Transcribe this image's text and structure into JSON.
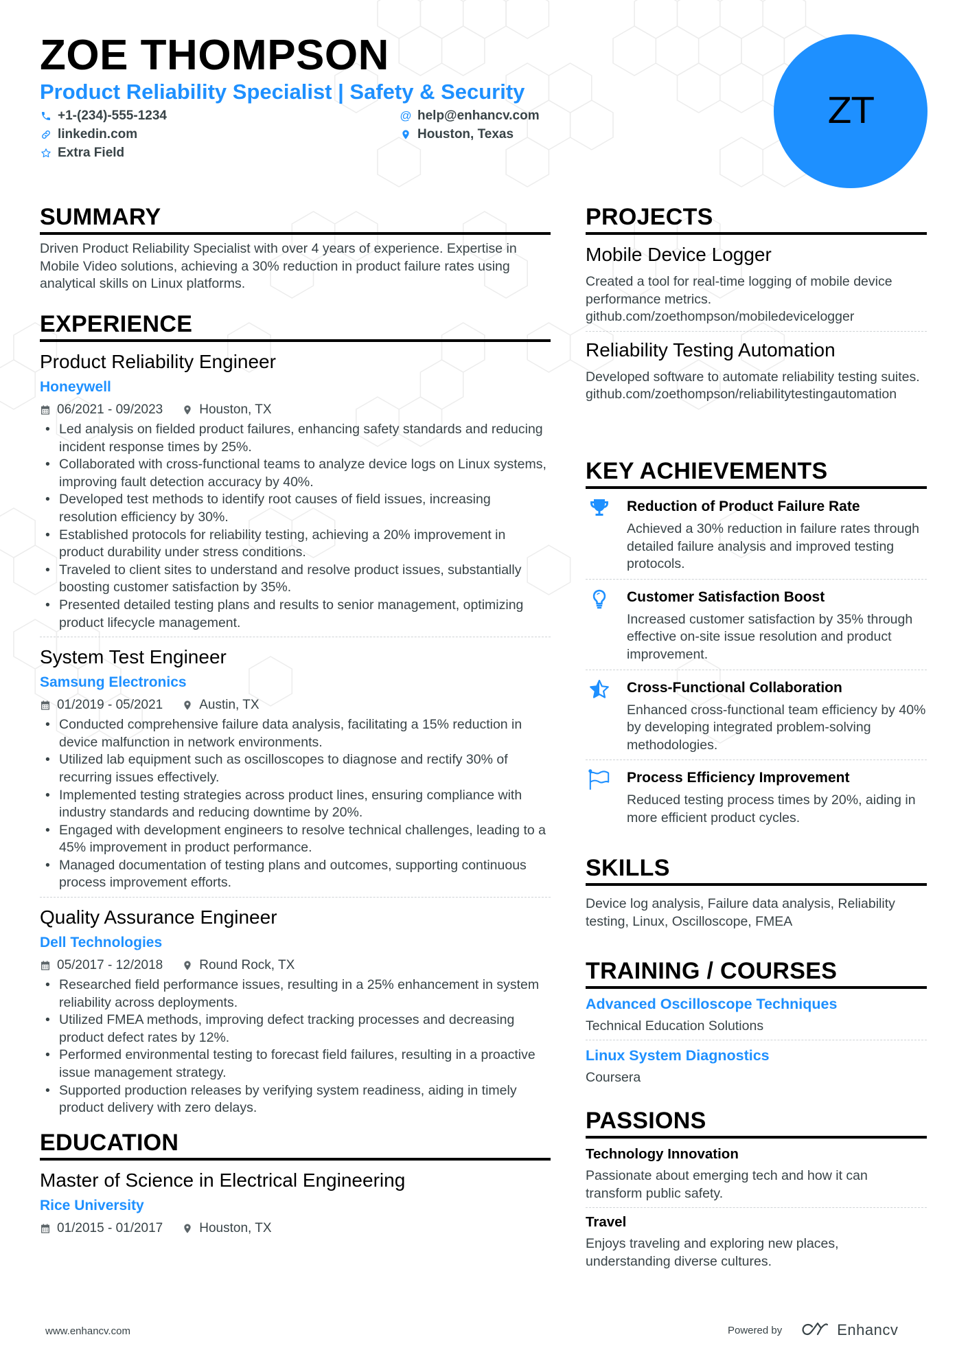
{
  "header": {
    "name": "ZOE THOMPSON",
    "title": "Product Reliability Specialist | Safety & Security",
    "avatar_initials": "ZT",
    "contacts": {
      "phone": "+1-(234)-555-1234",
      "email": "help@enhancv.com",
      "linkedin": "linkedin.com",
      "location": "Houston, Texas",
      "extra": "Extra Field"
    }
  },
  "colors": {
    "accent": "#1e90ff",
    "text": "#384347",
    "heading": "#000000"
  },
  "summary": {
    "heading": "SUMMARY",
    "text": "Driven Product Reliability Specialist with over 4 years of experience. Expertise in Mobile Video solutions, achieving a 30% reduction in product failure rates using analytical skills on Linux platforms."
  },
  "experience": {
    "heading": "EXPERIENCE",
    "jobs": [
      {
        "title": "Product Reliability Engineer",
        "company": "Honeywell",
        "dates": "06/2021 - 09/2023",
        "location": "Houston, TX",
        "bullets": [
          "Led analysis on fielded product failures, enhancing safety standards and reducing incident response times by 25%.",
          "Collaborated with cross-functional teams to analyze device logs on Linux systems, improving fault detection accuracy by 40%.",
          "Developed test methods to identify root causes of field issues, increasing resolution efficiency by 30%.",
          "Established protocols for reliability testing, achieving a 20% improvement in product durability under stress conditions.",
          "Traveled to client sites to understand and resolve product issues, substantially boosting customer satisfaction by 35%.",
          "Presented detailed testing plans and results to senior management, optimizing product lifecycle management."
        ]
      },
      {
        "title": "System Test Engineer",
        "company": "Samsung Electronics",
        "dates": "01/2019 - 05/2021",
        "location": "Austin, TX",
        "bullets": [
          "Conducted comprehensive failure data analysis, facilitating a 15% reduction in device malfunction in network environments.",
          "Utilized lab equipment such as oscilloscopes to diagnose and rectify 30% of recurring issues effectively.",
          "Implemented testing strategies across product lines, ensuring compliance with industry standards and reducing downtime by 20%.",
          "Engaged with development engineers to resolve technical challenges, leading to a 45% improvement in product performance.",
          "Managed documentation of testing plans and outcomes, supporting continuous process improvement efforts."
        ]
      },
      {
        "title": "Quality Assurance Engineer",
        "company": "Dell Technologies",
        "dates": "05/2017 - 12/2018",
        "location": "Round Rock, TX",
        "bullets": [
          "Researched field performance issues, resulting in a 25% enhancement in system reliability across deployments.",
          "Utilized FMEA methods, improving defect tracking processes and decreasing product defect rates by 12%.",
          "Performed environmental testing to forecast field failures, resulting in a proactive issue management strategy.",
          "Supported production releases by verifying system readiness, aiding in timely product delivery with zero delays."
        ]
      }
    ]
  },
  "education": {
    "heading": "EDUCATION",
    "items": [
      {
        "degree": "Master of Science in Electrical Engineering",
        "school": "Rice University",
        "dates": "01/2015 - 01/2017",
        "location": "Houston, TX"
      }
    ]
  },
  "projects": {
    "heading": "PROJECTS",
    "items": [
      {
        "title": "Mobile Device Logger",
        "description": "Created a tool for real-time logging of mobile device performance metrics.",
        "link": "github.com/zoethompson/mobiledevicelogger"
      },
      {
        "title": "Reliability Testing Automation",
        "description": "Developed software to automate reliability testing suites.",
        "link": "github.com/zoethompson/reliabilitytestingautomation"
      }
    ]
  },
  "achievements": {
    "heading": "KEY ACHIEVEMENTS",
    "items": [
      {
        "icon": "trophy-icon",
        "title": "Reduction of Product Failure Rate",
        "description": "Achieved a 30% reduction in failure rates through detailed failure analysis and improved testing protocols."
      },
      {
        "icon": "lightbulb-icon",
        "title": "Customer Satisfaction Boost",
        "description": "Increased customer satisfaction by 35% through effective on-site issue resolution and product improvement."
      },
      {
        "icon": "star-half-icon",
        "title": "Cross-Functional Collaboration",
        "description": "Enhanced cross-functional team efficiency by 40% by developing integrated problem-solving methodologies."
      },
      {
        "icon": "flag-icon",
        "title": "Process Efficiency Improvement",
        "description": "Reduced testing process times by 20%, aiding in more efficient product cycles."
      }
    ]
  },
  "skills": {
    "heading": "SKILLS",
    "text": "Device log analysis, Failure data analysis, Reliability testing, Linux, Oscilloscope, FMEA"
  },
  "training": {
    "heading": "TRAINING / COURSES",
    "items": [
      {
        "title": "Advanced Oscilloscope Techniques",
        "provider": "Technical Education Solutions"
      },
      {
        "title": "Linux System Diagnostics",
        "provider": "Coursera"
      }
    ]
  },
  "passions": {
    "heading": "PASSIONS",
    "items": [
      {
        "title": "Technology Innovation",
        "description": "Passionate about emerging tech and how it can transform public safety."
      },
      {
        "title": "Travel",
        "description": "Enjoys traveling and exploring new places, understanding diverse cultures."
      }
    ]
  },
  "footer": {
    "website": "www.enhancv.com",
    "powered_by": "Powered by",
    "brand": "Enhancv"
  }
}
